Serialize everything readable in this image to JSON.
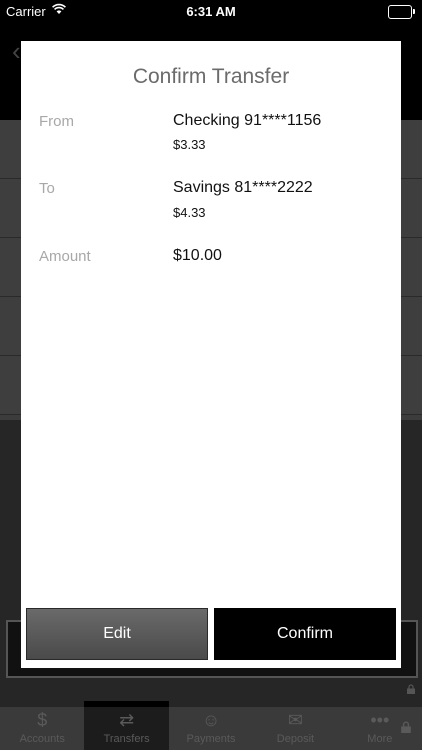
{
  "status_bar": {
    "carrier": "Carrier",
    "time": "6:31 AM",
    "battery_level": 1.0
  },
  "modal": {
    "title": "Confirm Transfer",
    "from": {
      "label": "From",
      "account": "Checking 91****1156",
      "balance": "$3.33"
    },
    "to": {
      "label": "To",
      "account": "Savings 81****2222",
      "balance": "$4.33"
    },
    "amount": {
      "label": "Amount",
      "value": "$10.00"
    },
    "buttons": {
      "edit": "Edit",
      "confirm": "Confirm"
    }
  },
  "tab_bar": {
    "items": [
      {
        "label": "Accounts",
        "icon": "dollar-icon"
      },
      {
        "label": "Transfers",
        "icon": "transfer-icon",
        "active": true
      },
      {
        "label": "Payments",
        "icon": "payments-icon"
      },
      {
        "label": "Deposit",
        "icon": "deposit-icon"
      },
      {
        "label": "More",
        "icon": "more-icon"
      }
    ]
  },
  "colors": {
    "modal_background": "#ffffff",
    "confirm_button": "#000000",
    "edit_button": "#5a5a5a"
  }
}
